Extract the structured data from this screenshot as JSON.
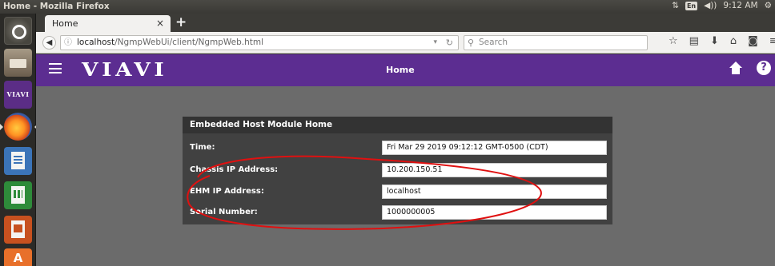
{
  "os": {
    "window_title": "Home - Mozilla Firefox",
    "tray": {
      "lang": "En",
      "time": "9:12 AM"
    }
  },
  "browser": {
    "tab_title": "Home",
    "url_host": "localhost",
    "url_path": "/NgmpWebUi/client/NgmpWeb.html",
    "search_placeholder": "Search"
  },
  "app": {
    "logo": "VIAVI",
    "launcher_viavi": "VIAVI",
    "page_title": "Home",
    "help_label": "?"
  },
  "card": {
    "title": "Embedded Host Module Home",
    "rows": [
      {
        "label": "Time:",
        "value": "Fri Mar 29 2019 09:12:12 GMT-0500 (CDT)"
      },
      {
        "label": "Chassis IP Address:",
        "value": "10.200.150.51"
      },
      {
        "label": "EHM IP Address:",
        "value": "localhost"
      },
      {
        "label": "Serial Number:",
        "value": "1000000005"
      }
    ]
  },
  "annotation": {
    "color": "#e01010"
  }
}
